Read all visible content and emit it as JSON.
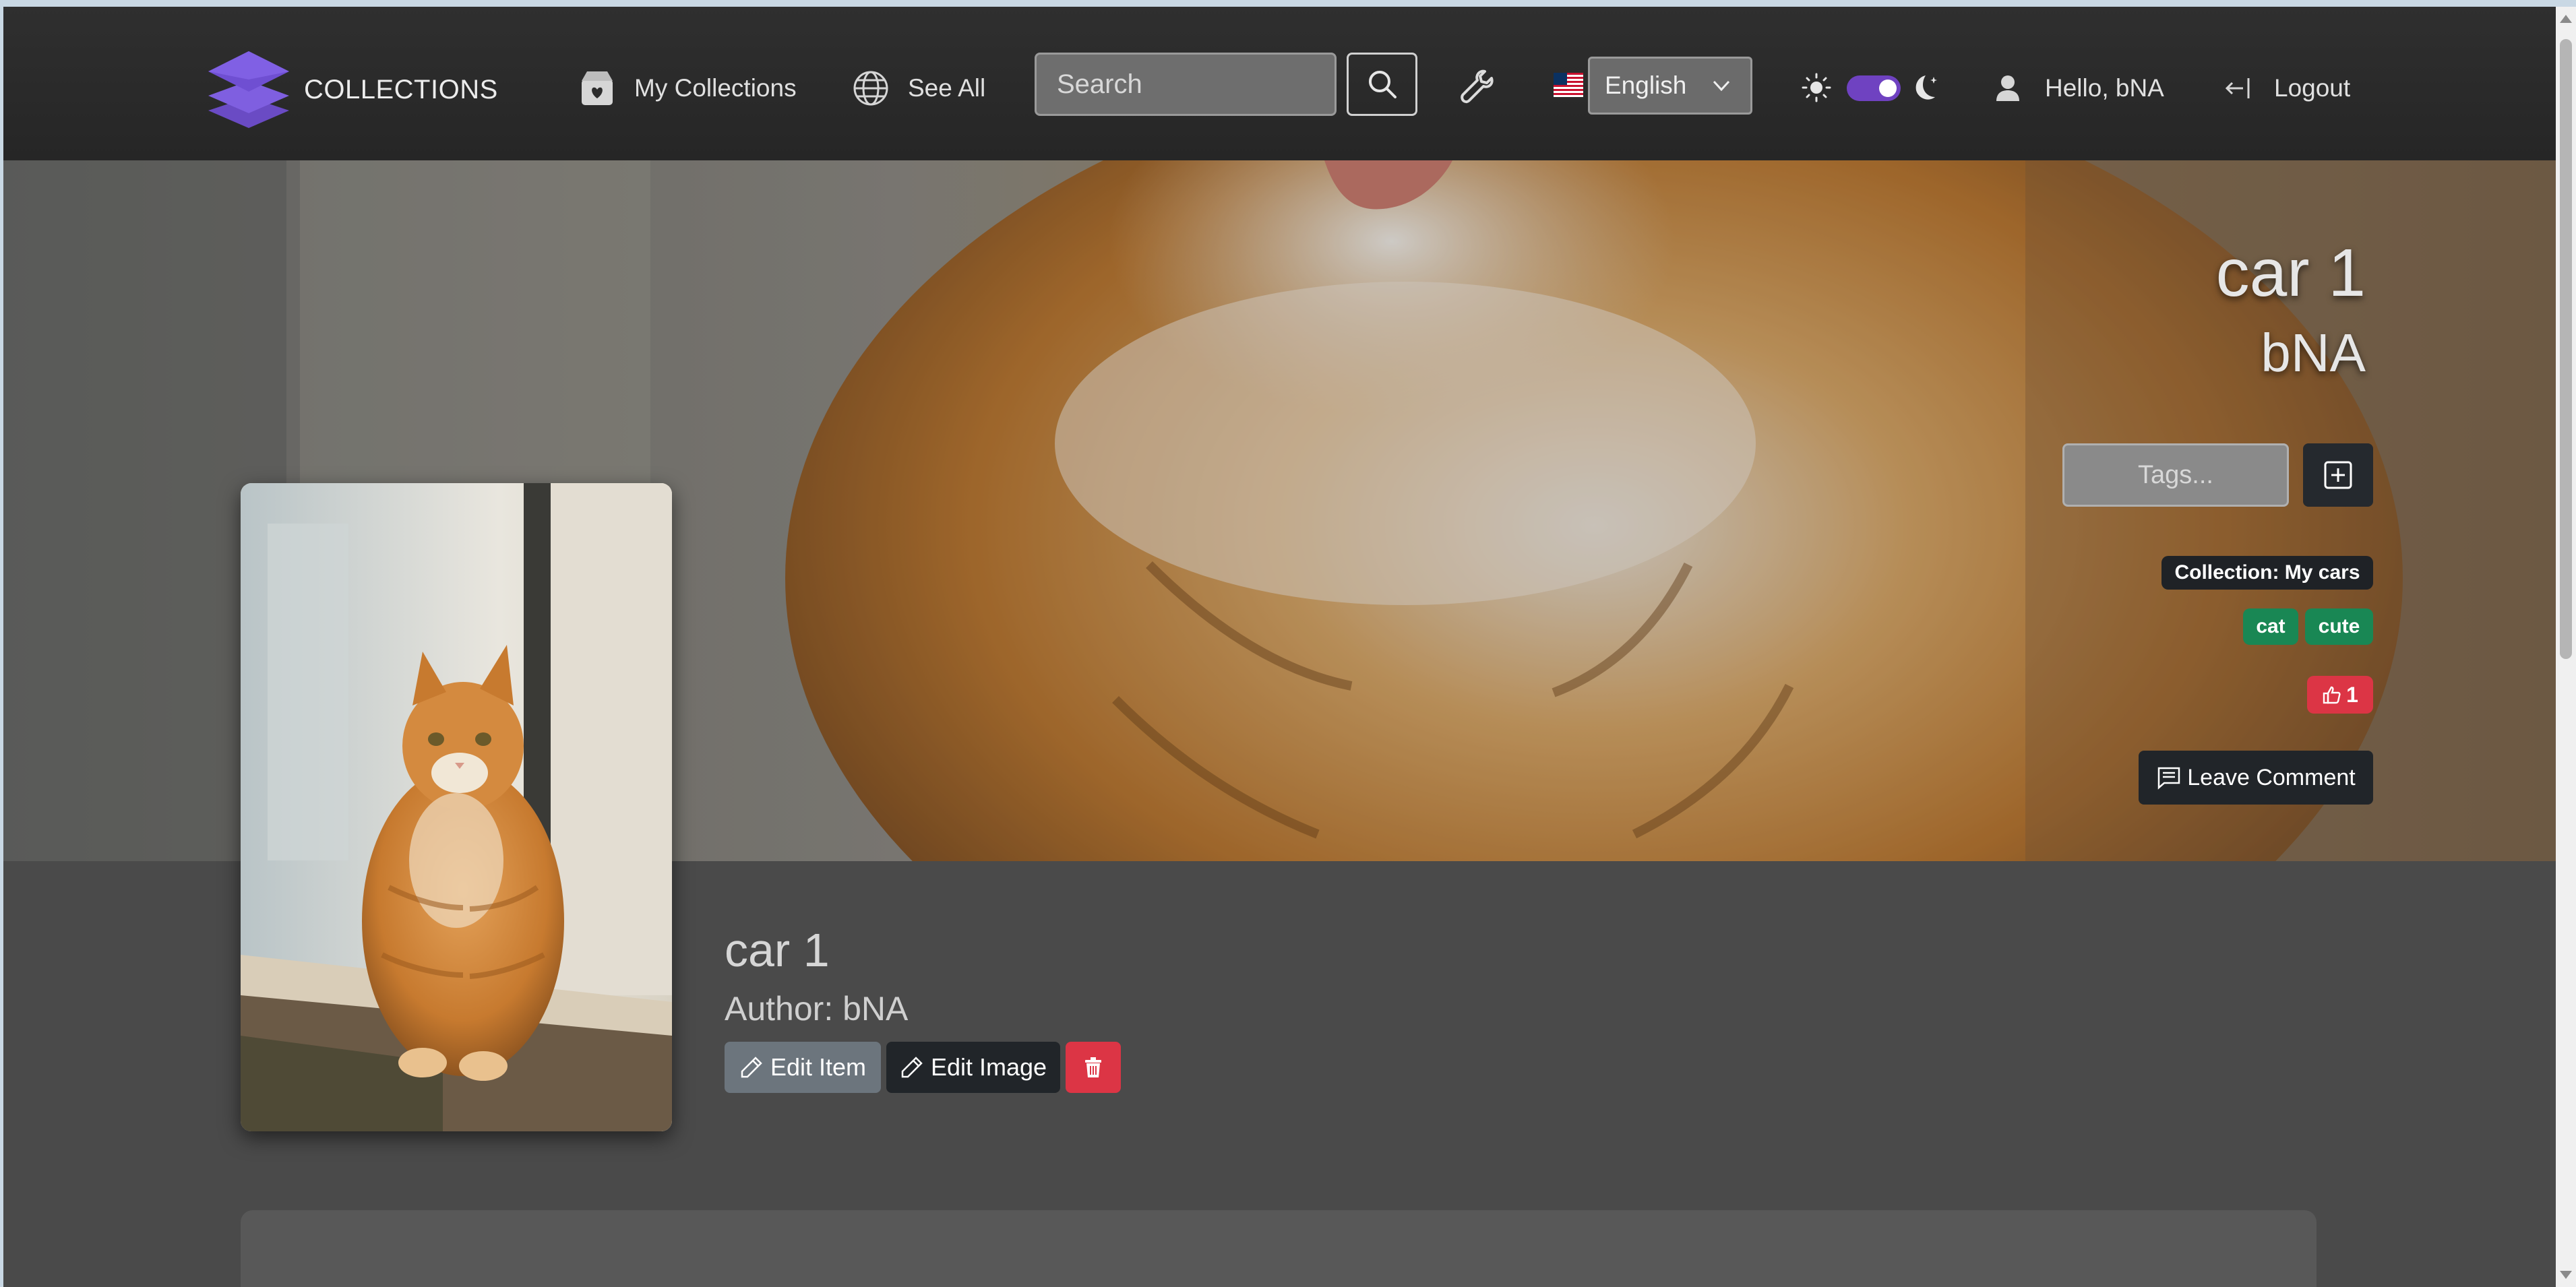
{
  "navbar": {
    "brand": "COLLECTIONS",
    "my_collections": "My Collections",
    "see_all": "See All",
    "search_placeholder": "Search",
    "language": "English",
    "greeting": "Hello, bNA",
    "logout": "Logout",
    "theme_toggle_on": true,
    "toggle_color": "#6f42c1"
  },
  "hero": {
    "title": "car 1",
    "author": "bNA",
    "tags_placeholder": "Tags...",
    "collection_badge": "Collection: My cars",
    "tags": [
      "cat",
      "cute"
    ],
    "likes": "1",
    "leave_comment": "Leave Comment"
  },
  "item": {
    "title": "car 1",
    "author_line": "Author: bNA",
    "edit_item": "Edit Item",
    "edit_image": "Edit Image"
  },
  "colors": {
    "tag_green": "#198754",
    "danger_red": "#dc3545",
    "dark_btn": "#212529",
    "secondary_btn": "#6c757d"
  }
}
